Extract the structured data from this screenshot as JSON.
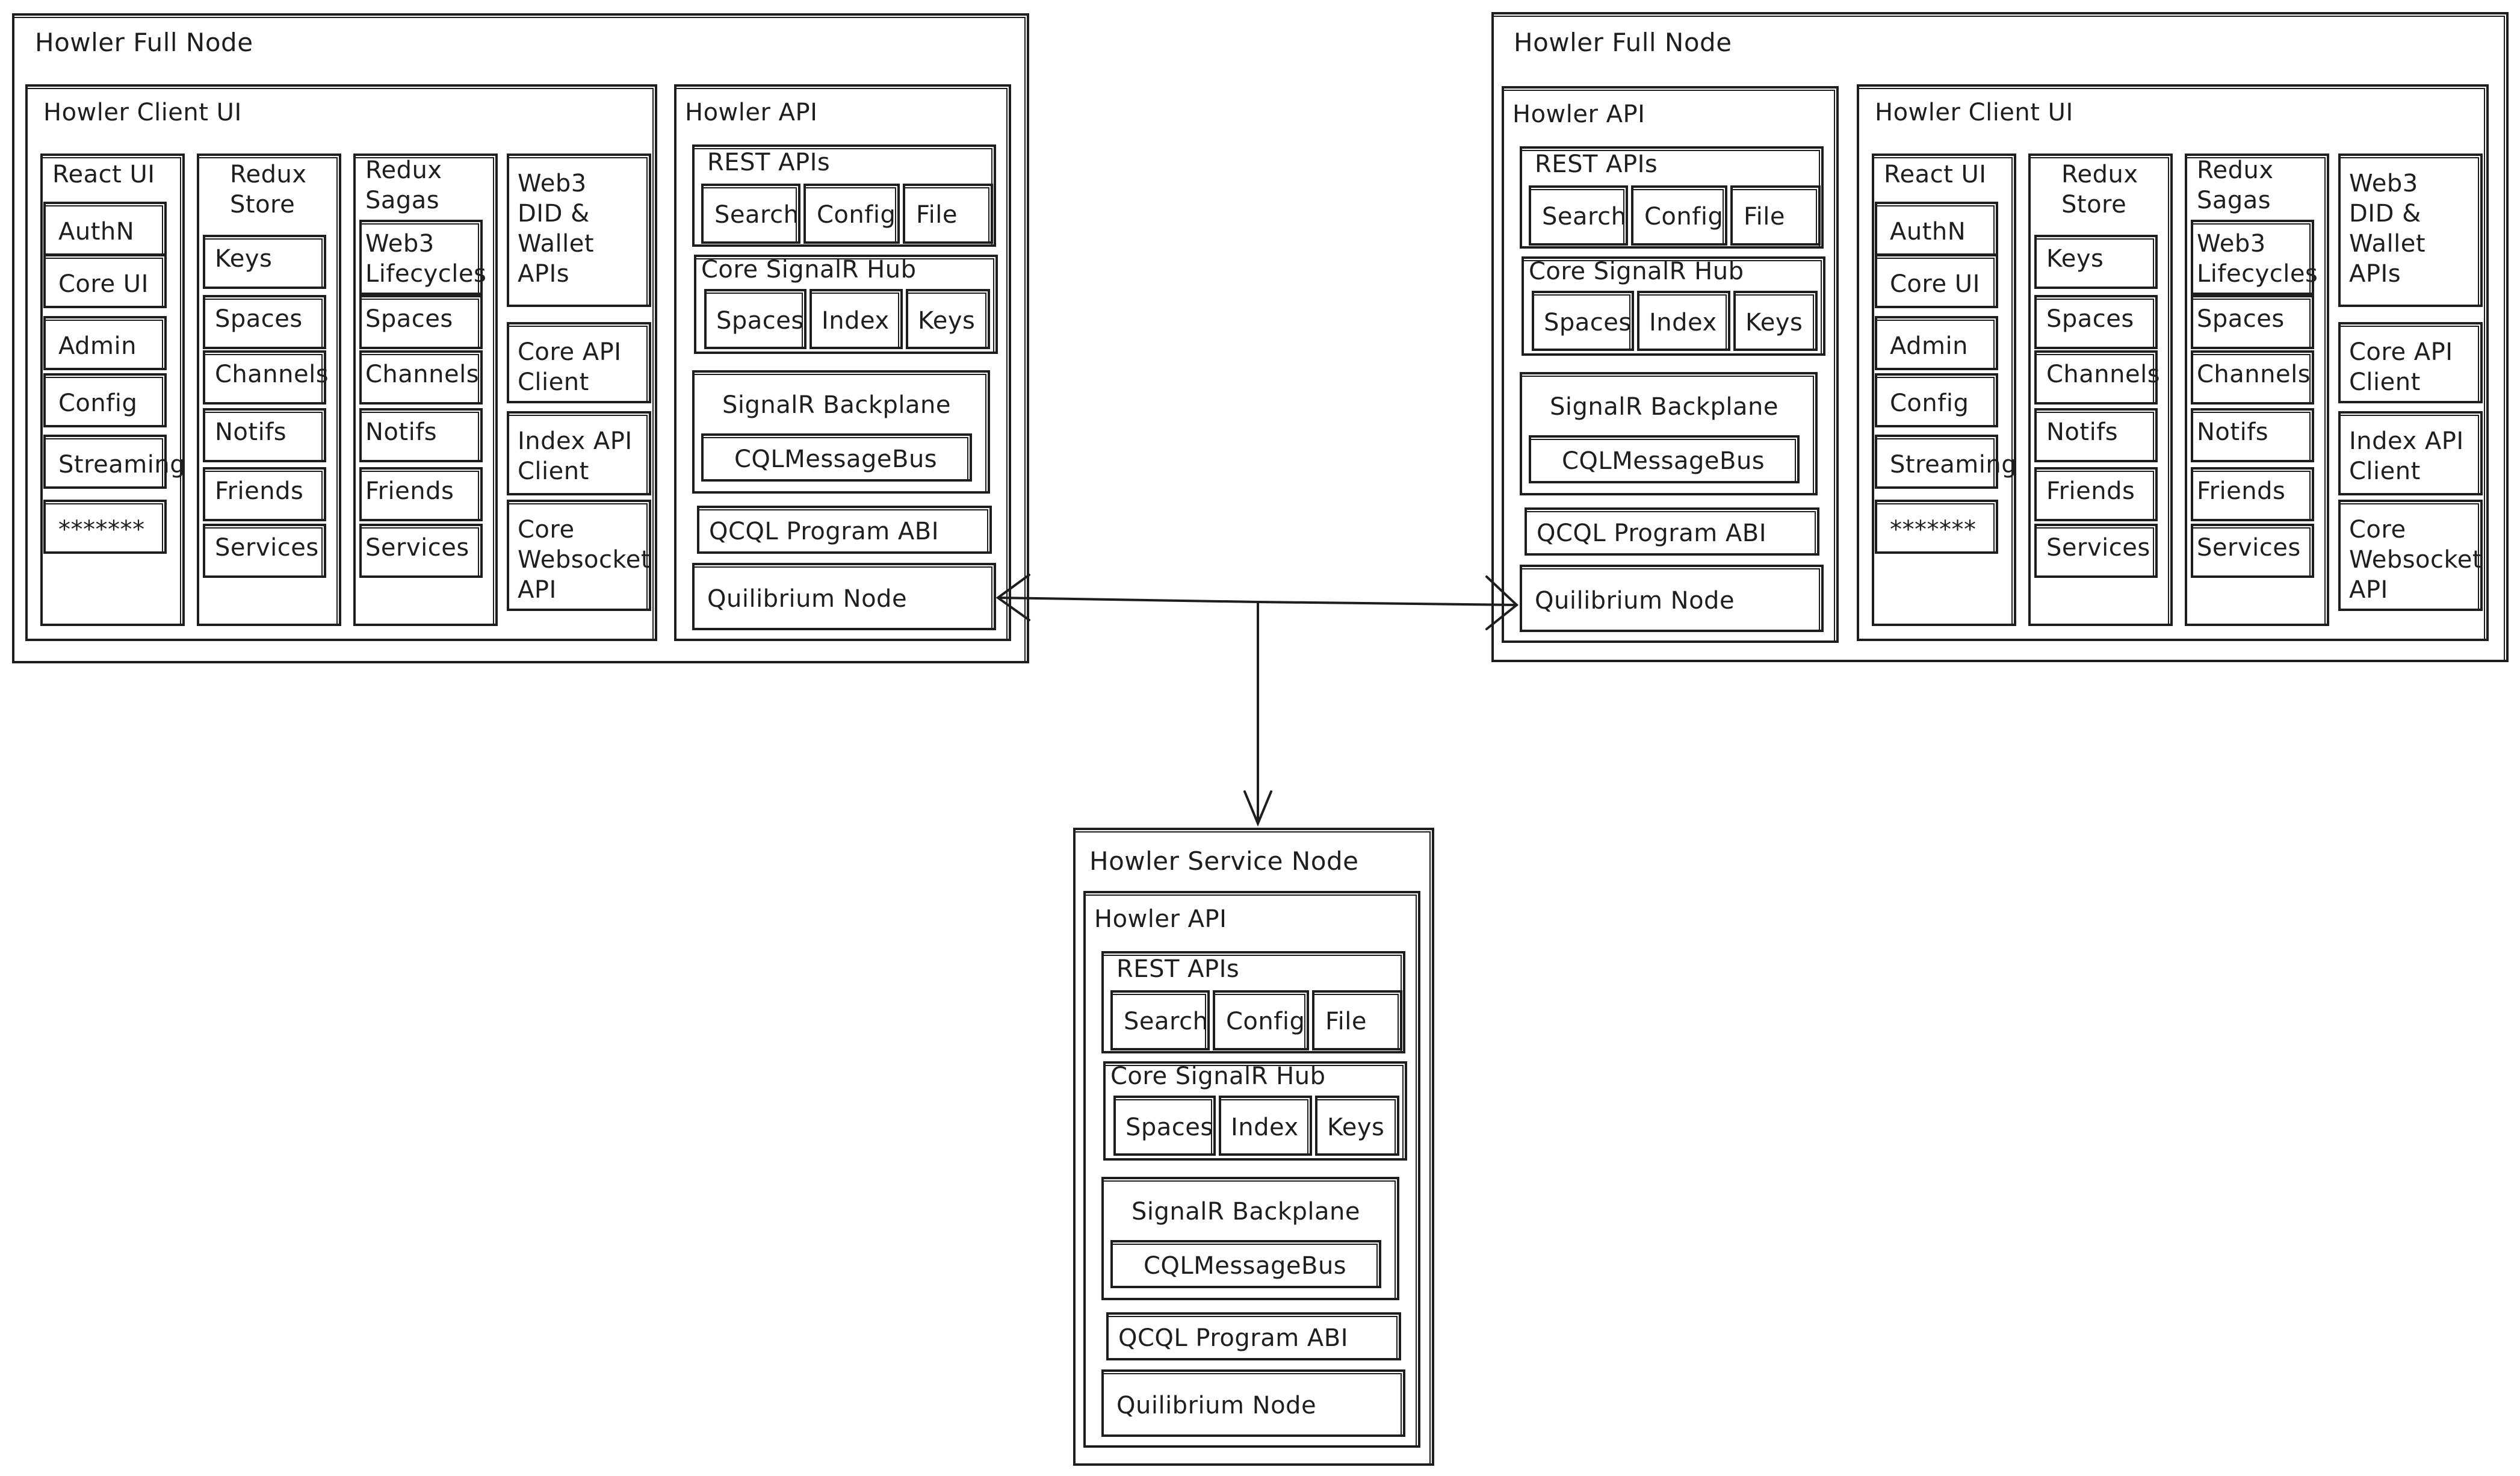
{
  "full_node_left": {
    "title": "Howler Full Node",
    "client_ui": {
      "title": "Howler Client UI",
      "react_ui": {
        "title": "React UI",
        "items": [
          "AuthN",
          "Core UI",
          "Admin",
          "Config",
          "Streaming",
          "*******"
        ]
      },
      "redux_store": {
        "title": "Redux\nStore",
        "items": [
          "Keys",
          "Spaces",
          "Channels",
          "Notifs",
          "Friends",
          "Services"
        ]
      },
      "redux_sagas": {
        "title": "Redux\nSagas",
        "items": [
          "Web3\nLifecycles",
          "Spaces",
          "Channels",
          "Notifs",
          "Friends",
          "Services"
        ]
      },
      "web3_col": {
        "items": [
          "Web3\nDID &\nWallet\nAPIs",
          "Core API\nClient",
          "Index API\nClient",
          "Core\nWebsocket\nAPI"
        ]
      }
    },
    "api": {
      "title": "Howler API",
      "rest": {
        "title": "REST APIs",
        "items": [
          "Search",
          "Config",
          "File"
        ]
      },
      "hub": {
        "title": "Core SignalR Hub",
        "items": [
          "Spaces",
          "Index",
          "Keys"
        ]
      },
      "backplane": {
        "title": "SignalR Backplane",
        "bus": "CQLMessageBus"
      },
      "abi": "QCQL Program ABI",
      "node": "Quilibrium Node"
    }
  },
  "full_node_right": {
    "title": "Howler Full Node",
    "client_ui": {
      "title": "Howler Client UI",
      "react_ui": {
        "title": "React UI",
        "items": [
          "AuthN",
          "Core UI",
          "Admin",
          "Config",
          "Streaming",
          "*******"
        ]
      },
      "redux_store": {
        "title": "Redux\nStore",
        "items": [
          "Keys",
          "Spaces",
          "Channels",
          "Notifs",
          "Friends",
          "Services"
        ]
      },
      "redux_sagas": {
        "title": "Redux\nSagas",
        "items": [
          "Web3\nLifecycles",
          "Spaces",
          "Channels",
          "Notifs",
          "Friends",
          "Services"
        ]
      },
      "web3_col": {
        "items": [
          "Web3\nDID &\nWallet\nAPIs",
          "Core API\nClient",
          "Index API\nClient",
          "Core\nWebsocket\nAPI"
        ]
      }
    },
    "api": {
      "title": "Howler API",
      "rest": {
        "title": "REST APIs",
        "items": [
          "Search",
          "Config",
          "File"
        ]
      },
      "hub": {
        "title": "Core SignalR Hub",
        "items": [
          "Spaces",
          "Index",
          "Keys"
        ]
      },
      "backplane": {
        "title": "SignalR Backplane",
        "bus": "CQLMessageBus"
      },
      "abi": "QCQL Program ABI",
      "node": "Quilibrium Node"
    }
  },
  "service_node": {
    "title": "Howler Service Node",
    "api": {
      "title": "Howler API",
      "rest": {
        "title": "REST APIs",
        "items": [
          "Search",
          "Config",
          "File"
        ]
      },
      "hub": {
        "title": "Core SignalR Hub",
        "items": [
          "Spaces",
          "Index",
          "Keys"
        ]
      },
      "backplane": {
        "title": "SignalR Backplane",
        "bus": "CQLMessageBus"
      },
      "abi": "QCQL Program ABI",
      "node": "Quilibrium Node"
    }
  },
  "connections": [
    {
      "from": "junction",
      "to": "full_node_left.api.node",
      "arrow": "end"
    },
    {
      "from": "junction",
      "to": "full_node_right.api.node",
      "arrow": "end"
    },
    {
      "from": "junction",
      "to": "service_node",
      "arrow": "end"
    }
  ]
}
